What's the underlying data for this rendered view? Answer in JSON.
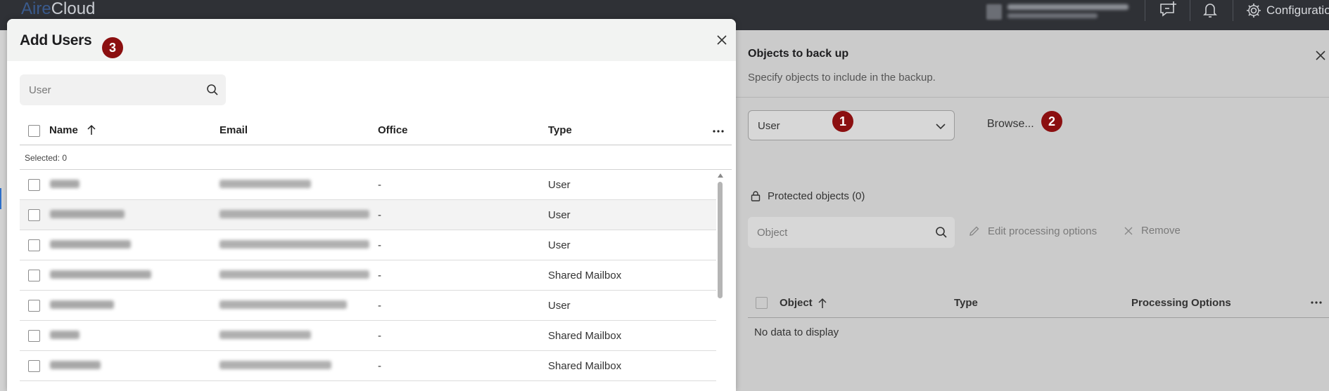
{
  "topbar": {
    "logo_part1": "Aire",
    "logo_part2": "Cloud",
    "configuration_label": "Configuratio"
  },
  "right_panel": {
    "title": "Objects to back up",
    "subtitle": "Specify objects to include in the backup.",
    "type_select_value": "User",
    "browse_label": "Browse...",
    "badge_1": "1",
    "badge_2": "2",
    "protected_label": "Protected objects (0)",
    "search_placeholder": "Object",
    "edit_label": "Edit processing options",
    "remove_label": "Remove",
    "columns": [
      "Object",
      "Type",
      "Processing Options"
    ],
    "empty_text": "No data to display"
  },
  "modal": {
    "title": "Add Users",
    "badge_3": "3",
    "search_placeholder": "User",
    "columns": [
      "Name",
      "Email",
      "Office",
      "Type"
    ],
    "selected_text": "Selected: 0",
    "rows": [
      {
        "office": "-",
        "type": "User"
      },
      {
        "office": "-",
        "type": "User"
      },
      {
        "office": "-",
        "type": "User"
      },
      {
        "office": "-",
        "type": "Shared Mailbox"
      },
      {
        "office": "-",
        "type": "User"
      },
      {
        "office": "-",
        "type": "Shared Mailbox"
      },
      {
        "office": "-",
        "type": "Shared Mailbox"
      }
    ]
  },
  "colors": {
    "badge": "#8b0f10",
    "topbar": "#2f3136",
    "overlay_panel": "#cbcbcb"
  }
}
